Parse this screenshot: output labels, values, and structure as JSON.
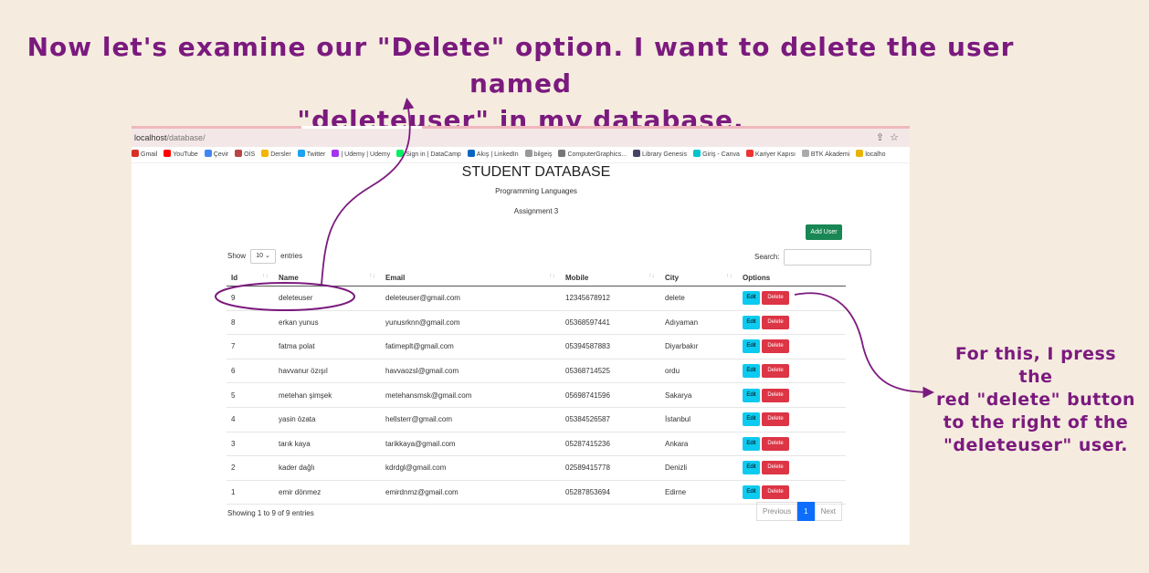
{
  "annotation": {
    "headline_line1": "Now let's examine our \"Delete\" option. I want to delete the user named",
    "headline_line2": "\"deleteuser\" in my database.",
    "side_note_lines": [
      "For this, I press the",
      "red \"delete\" button",
      "to the right of the",
      "\"deleteuser\" user."
    ],
    "color": "#7b1a7e"
  },
  "browser": {
    "url_host": "localhost",
    "url_path": "/database/",
    "bookmarks": [
      {
        "label": "Gmail",
        "icon": "gmail-icon",
        "color": "#d93025"
      },
      {
        "label": "YouTube",
        "icon": "youtube-icon",
        "color": "#ff0000"
      },
      {
        "label": "Çevir",
        "icon": "translate-icon",
        "color": "#4285f4"
      },
      {
        "label": "OİS",
        "icon": "ois-icon",
        "color": "#b44"
      },
      {
        "label": "Dersler",
        "icon": "dersler-icon",
        "color": "#f4b400"
      },
      {
        "label": "Twitter",
        "icon": "twitter-icon",
        "color": "#1da1f2"
      },
      {
        "label": "| Udemy | Udemy",
        "icon": "udemy-icon",
        "color": "#a435f0"
      },
      {
        "label": "Sign in | DataCamp",
        "icon": "datacamp-icon",
        "color": "#03ef62"
      },
      {
        "label": "Akış | LinkedIn",
        "icon": "linkedin-icon",
        "color": "#0a66c2"
      },
      {
        "label": "bilgeiş",
        "icon": "bilgeis-icon",
        "color": "#999"
      },
      {
        "label": "ComputerGraphics...",
        "icon": "graphics-icon",
        "color": "#777"
      },
      {
        "label": "Library Genesis",
        "icon": "library-icon",
        "color": "#446"
      },
      {
        "label": "Giriş - Canva",
        "icon": "canva-icon",
        "color": "#00c4cc"
      },
      {
        "label": "Kariyer Kapısı",
        "icon": "kariyer-icon",
        "color": "#e33"
      },
      {
        "label": "BTK Akademi",
        "icon": "btk-icon",
        "color": "#aaa"
      },
      {
        "label": "localho",
        "icon": "folder-icon",
        "color": "#e8b400"
      }
    ]
  },
  "page": {
    "title": "STUDENT DATABASE",
    "subtitle": "Programming Languages",
    "assignment": "Assignment 3",
    "add_user": "Add User",
    "show_label": "Show",
    "entries_value": "10",
    "entries_label": "entries",
    "search_label": "Search:",
    "info": "Showing 1 to 9 of 9 entries",
    "pager": {
      "previous": "Previous",
      "current": "1",
      "next": "Next"
    },
    "edit_label": "Edit",
    "delete_label": "Delete"
  },
  "table": {
    "headers": [
      "Id",
      "Name",
      "Email",
      "Mobile",
      "City",
      "Options"
    ],
    "rows": [
      [
        "9",
        "deleteuser",
        "deleteuser@gmail.com",
        "12345678912",
        "delete"
      ],
      [
        "8",
        "erkan yunus",
        "yunusrknn@gmail.com",
        "05368597441",
        "Adıyaman"
      ],
      [
        "7",
        "fatma polat",
        "fatimeplt@gmail.com",
        "05394587883",
        "Diyarbakır"
      ],
      [
        "6",
        "havvanur özışıl",
        "havvaozsl@gmail.com",
        "05368714525",
        "ordu"
      ],
      [
        "5",
        "metehan şimşek",
        "metehansmsk@gmail.com",
        "05698741596",
        "Sakarya"
      ],
      [
        "4",
        "yasin özata",
        "hellsterr@gmail.com",
        "05384526587",
        "İstanbul"
      ],
      [
        "3",
        "tarık kaya",
        "tarikkaya@gmail.com",
        "05287415236",
        "Ankara"
      ],
      [
        "2",
        "kader dağlı",
        "kdrdgl@gmail.com",
        "02589415778",
        "Denizli"
      ],
      [
        "1",
        "emir dönmez",
        "emirdnmz@gmail.com",
        "05287853694",
        "Edirne"
      ]
    ]
  }
}
